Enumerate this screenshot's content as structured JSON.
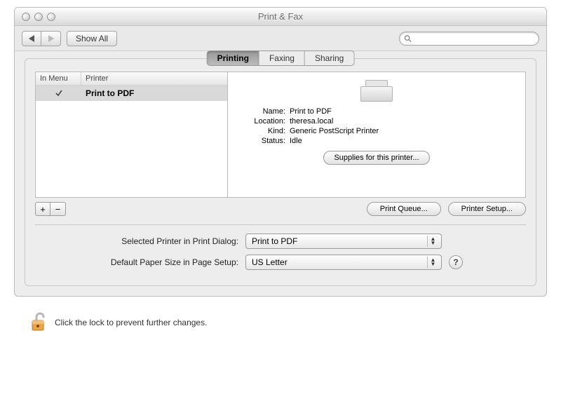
{
  "window": {
    "title": "Print & Fax"
  },
  "toolbar": {
    "show_all": "Show All",
    "search_placeholder": ""
  },
  "tabs": {
    "printing": "Printing",
    "faxing": "Faxing",
    "sharing": "Sharing",
    "active": "printing"
  },
  "printer_list": {
    "col_in_menu": "In Menu",
    "col_printer": "Printer",
    "rows": [
      {
        "in_menu": true,
        "name": "Print to PDF"
      }
    ]
  },
  "printer_info": {
    "labels": {
      "name": "Name:",
      "location": "Location:",
      "kind": "Kind:",
      "status": "Status:"
    },
    "name": "Print to PDF",
    "location": "theresa.local",
    "kind": "Generic PostScript Printer",
    "status": "Idle",
    "supplies_btn": "Supplies for this printer..."
  },
  "buttons": {
    "add": "+",
    "remove": "−",
    "print_queue": "Print Queue...",
    "printer_setup": "Printer Setup..."
  },
  "settings": {
    "selected_printer_label": "Selected Printer in Print Dialog:",
    "selected_printer_value": "Print to PDF",
    "default_paper_label": "Default Paper Size in Page Setup:",
    "default_paper_value": "US Letter"
  },
  "lock": {
    "text": "Click the lock to prevent further changes."
  },
  "help": "?"
}
